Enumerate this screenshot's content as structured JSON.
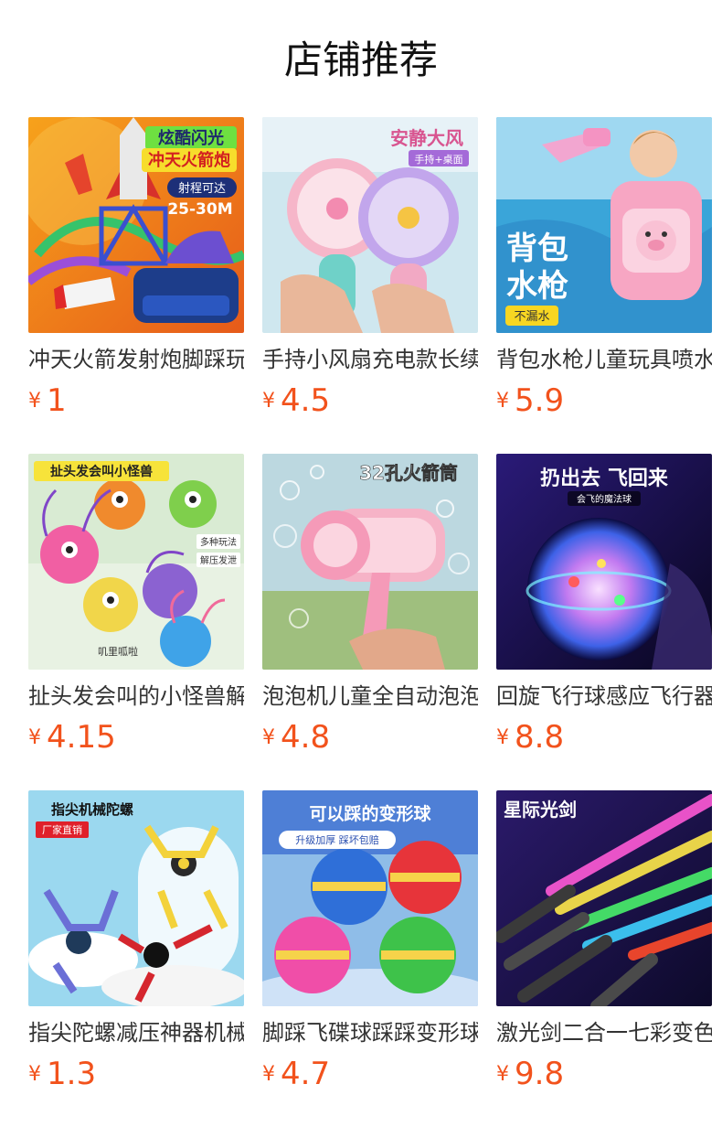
{
  "section": {
    "title": "店铺推荐"
  },
  "currency_symbol": "¥",
  "products": [
    {
      "name": "冲天火箭发射炮脚踩玩具",
      "price": "1",
      "image": {
        "banner": "炫酷闪光",
        "banner2": "冲天火箭炮",
        "badge": "射程可达",
        "badge2": "25-30M"
      }
    },
    {
      "name": "手持小风扇充电款长续航",
      "price": "4.5",
      "image": {
        "banner": "安静大风",
        "badge": "手持+桌面"
      }
    },
    {
      "name": "背包水枪儿童玩具喷水",
      "price": "5.9",
      "image": {
        "banner": "背包",
        "banner2": "水枪",
        "badge": "不漏水"
      }
    },
    {
      "name": "扯头发会叫的小怪兽解压玩具",
      "price": "4.15",
      "image": {
        "banner": "扯头发会叫小怪兽",
        "badge": "多种玩法",
        "badge2": "解压发泄",
        "caption": "叽里呱啦"
      }
    },
    {
      "name": "泡泡机儿童全自动泡泡枪",
      "price": "4.8",
      "image": {
        "banner": "32孔火箭筒"
      }
    },
    {
      "name": "回旋飞行球感应飞行器",
      "price": "8.8",
      "image": {
        "banner": "扔出去 飞回来",
        "badge": "会飞的魔法球"
      }
    },
    {
      "name": "指尖陀螺减压神器机械",
      "price": "1.3",
      "image": {
        "banner": "指尖机械陀螺",
        "badge": "厂家直销"
      }
    },
    {
      "name": "脚踩飞碟球踩踩变形球",
      "price": "4.7",
      "image": {
        "banner": "可以踩的变形球",
        "badge": "升级加厚 踩坏包赔"
      }
    },
    {
      "name": "激光剑二合一七彩变色",
      "price": "9.8",
      "image": {
        "banner": "星际光剑"
      }
    }
  ]
}
